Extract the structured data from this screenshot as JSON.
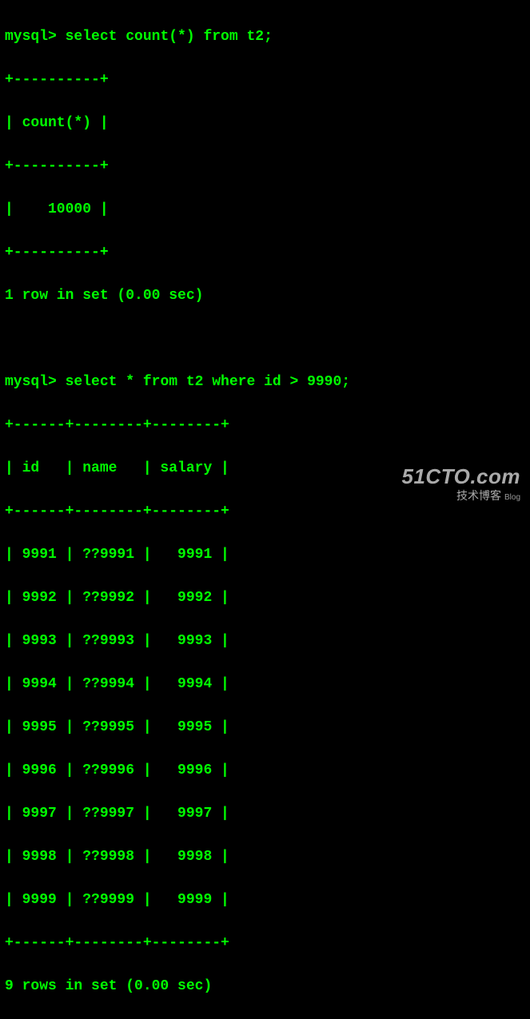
{
  "prompt": "mysql>",
  "query1": {
    "sql": "select count(*) from t2;",
    "border_top": "+----------+",
    "header_line": "| count(*) |",
    "border_mid": "+----------+",
    "value_line": "|    10000 |",
    "border_bot": "+----------+",
    "summary": "1 row in set (0.00 sec)"
  },
  "query2": {
    "sql": "select * from t2 where id > 9990;",
    "border_top": "+------+--------+--------+",
    "header_line": "| id   | name   | salary |",
    "border_mid": "+------+--------+--------+",
    "rows": [
      {
        "id": 9991,
        "name": "??9991",
        "salary": 9991,
        "line": "| 9991 | ??9991 |   9991 |"
      },
      {
        "id": 9992,
        "name": "??9992",
        "salary": 9992,
        "line": "| 9992 | ??9992 |   9992 |"
      },
      {
        "id": 9993,
        "name": "??9993",
        "salary": 9993,
        "line": "| 9993 | ??9993 |   9993 |"
      },
      {
        "id": 9994,
        "name": "??9994",
        "salary": 9994,
        "line": "| 9994 | ??9994 |   9994 |"
      },
      {
        "id": 9995,
        "name": "??9995",
        "salary": 9995,
        "line": "| 9995 | ??9995 |   9995 |"
      },
      {
        "id": 9996,
        "name": "??9996",
        "salary": 9996,
        "line": "| 9996 | ??9996 |   9996 |"
      },
      {
        "id": 9997,
        "name": "??9997",
        "salary": 9997,
        "line": "| 9997 | ??9997 |   9997 |"
      },
      {
        "id": 9998,
        "name": "??9998",
        "salary": 9998,
        "line": "| 9998 | ??9998 |   9998 |"
      },
      {
        "id": 9999,
        "name": "??9999",
        "salary": 9999,
        "line": "| 9999 | ??9999 |   9999 |"
      }
    ],
    "border_bot": "+------+--------+--------+",
    "summary": "9 rows in set (0.00 sec)"
  },
  "watermark": {
    "main": "51CTO.com",
    "sub": "技术博客",
    "blog": "Blog"
  }
}
